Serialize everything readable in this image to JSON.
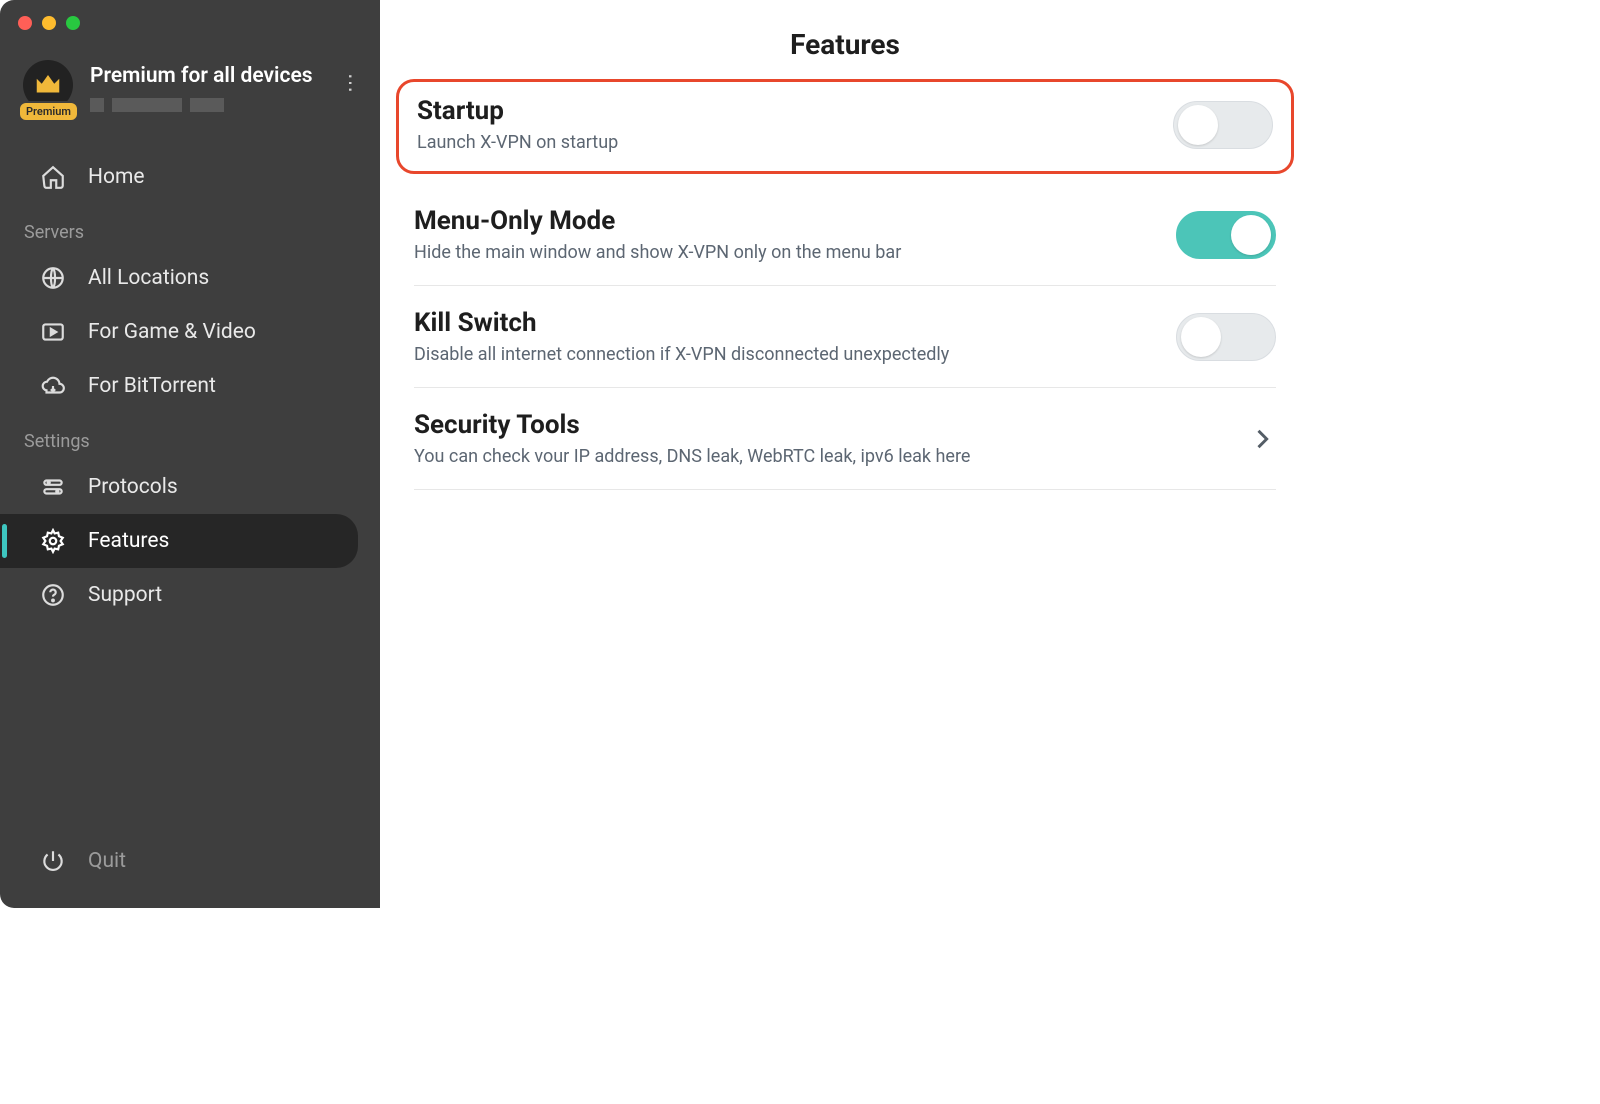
{
  "account": {
    "title": "Premium for all devices",
    "badge": "Premium"
  },
  "sidebar": {
    "home": "Home",
    "section_servers": "Servers",
    "all_locations": "All Locations",
    "game_video": "For Game & Video",
    "bittorrent": "For BitTorrent",
    "section_settings": "Settings",
    "protocols": "Protocols",
    "features": "Features",
    "support": "Support",
    "quit": "Quit"
  },
  "main": {
    "title": "Features",
    "rows": [
      {
        "title": "Startup",
        "desc": "Launch X-VPN on startup",
        "toggle": false,
        "highlighted": true
      },
      {
        "title": "Menu-Only Mode",
        "desc": "Hide the main window and show X-VPN only on the menu bar",
        "toggle": true
      },
      {
        "title": "Kill Switch",
        "desc": "Disable all internet connection if X-VPN disconnected unexpectedly",
        "toggle": false
      },
      {
        "title": "Security Tools",
        "desc": "You can check vour IP address, DNS leak, WebRTC leak, ipv6 leak here",
        "nav": true
      }
    ]
  }
}
